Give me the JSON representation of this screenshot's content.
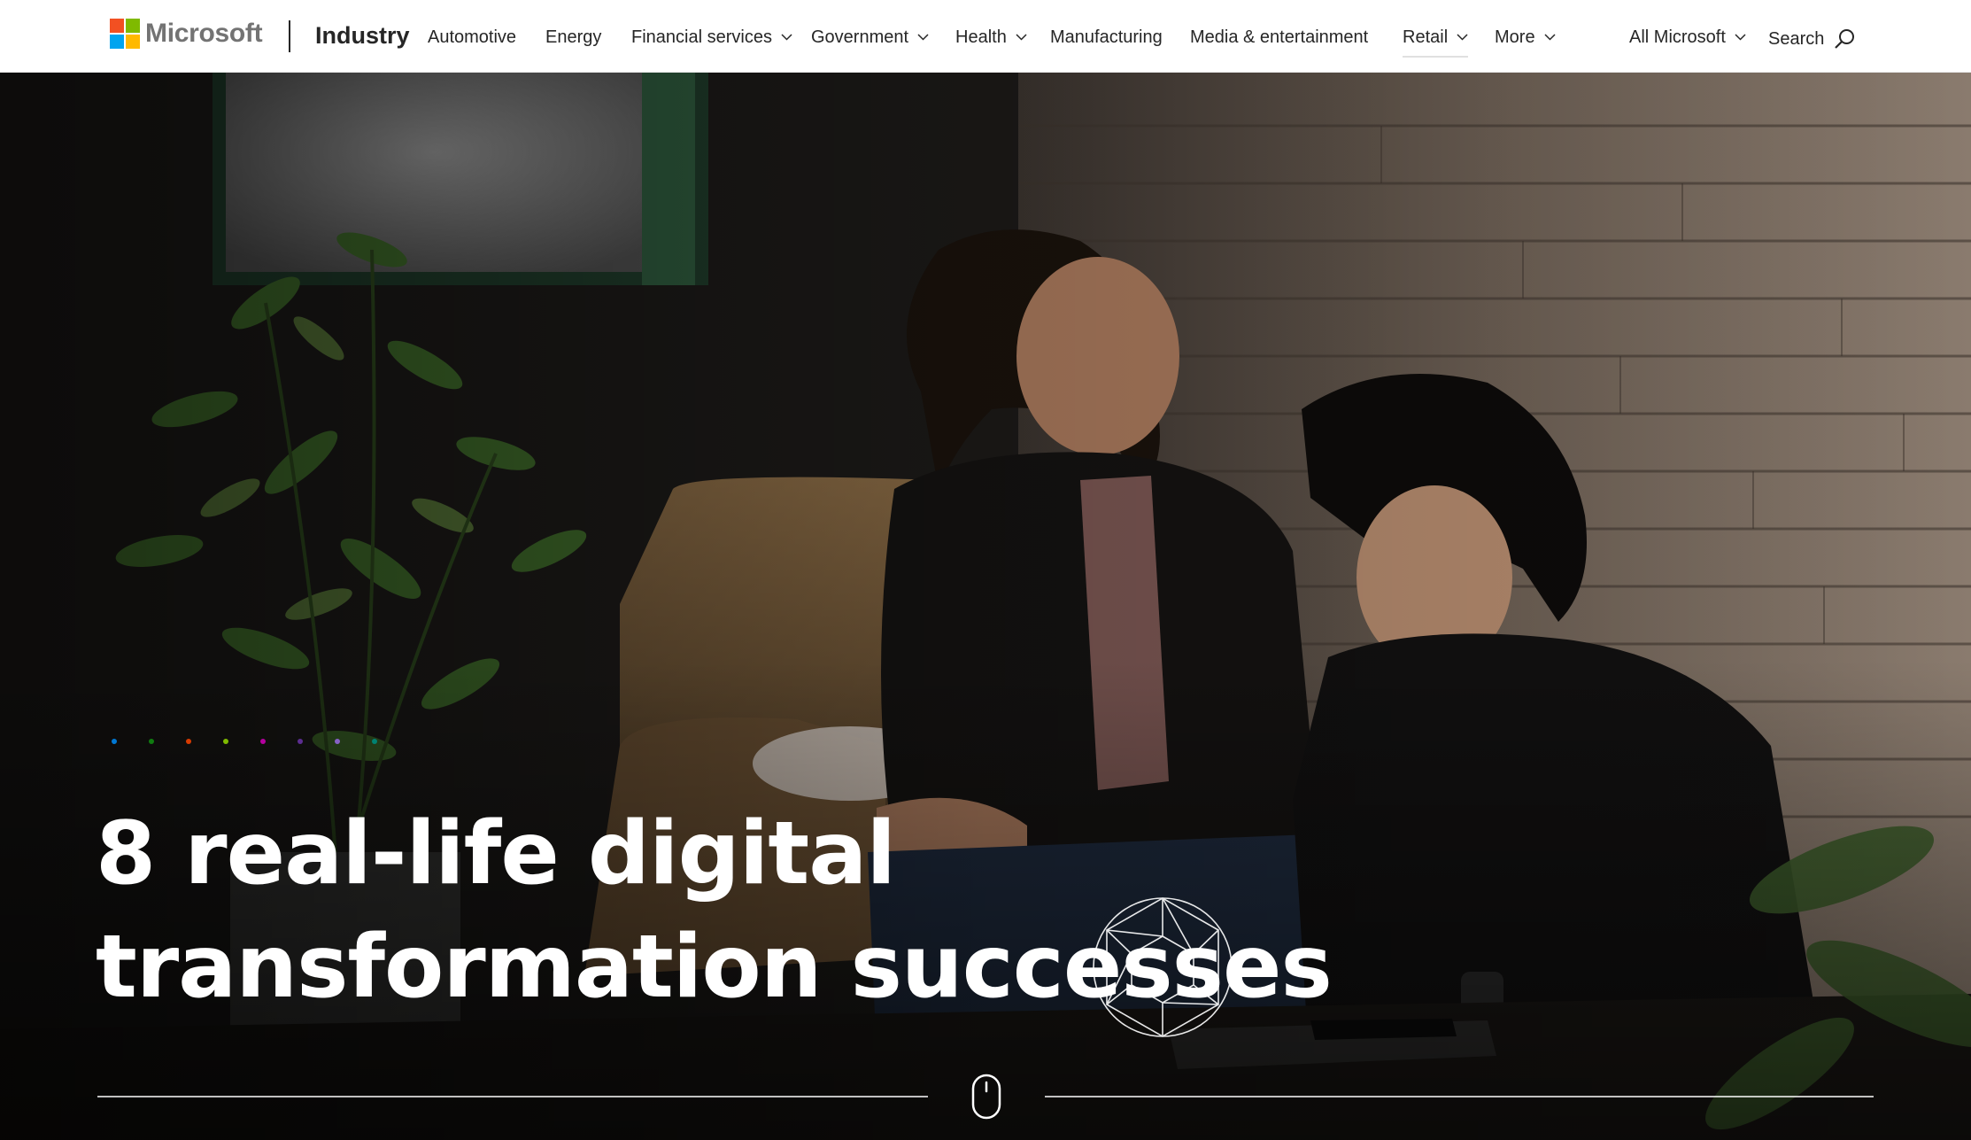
{
  "header": {
    "brand": "Microsoft",
    "site_title": "Industry",
    "nav": [
      {
        "label": "Automotive"
      },
      {
        "label": "Energy"
      },
      {
        "label": "Financial services",
        "icon": "chevron-down-icon"
      },
      {
        "label": "Government",
        "icon": "chevron-down-icon"
      },
      {
        "label": "Health",
        "icon": "chevron-down-icon"
      },
      {
        "label": "Manufacturing"
      },
      {
        "label": "Media & entertainment"
      },
      {
        "label": "Retail",
        "icon": "chevron-down-icon",
        "selected": true
      },
      {
        "label": "More",
        "icon": "chevron-down-icon"
      }
    ],
    "all_microsoft": "All Microsoft",
    "search_label": "Search"
  },
  "hero": {
    "title_line1": "8 real-life digital",
    "title_line2": "transformation successes",
    "accent_dots": [
      "#0078d4",
      "#107c10",
      "#d83b01",
      "#7fba00",
      "#b4009e",
      "#5c2d91",
      "#8661c5",
      "#008272"
    ],
    "scroll_icon": "mouse-scroll-icon"
  }
}
